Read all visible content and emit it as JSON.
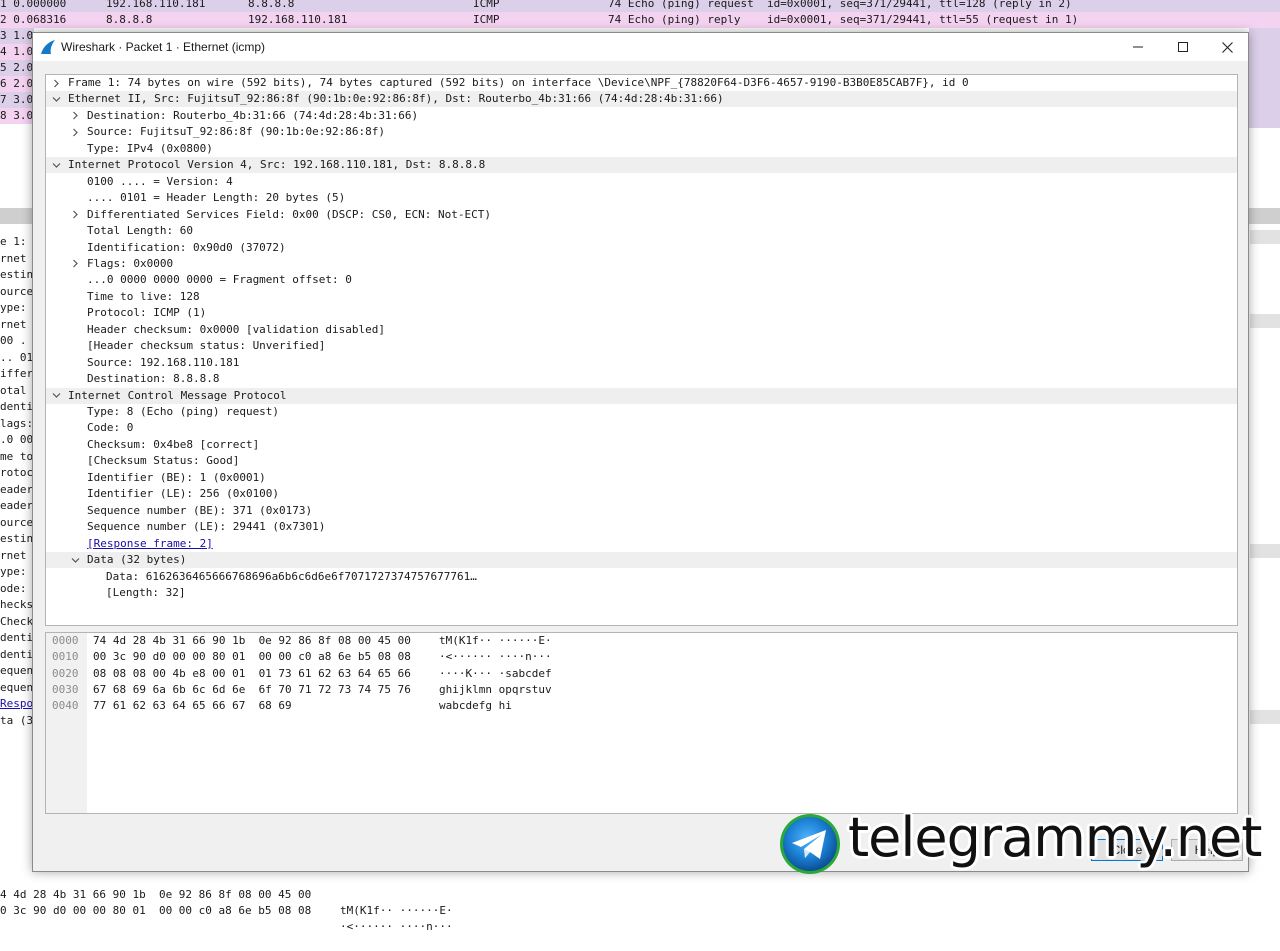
{
  "background": {
    "packet_list": [
      {
        "no_time": "1 0.000000",
        "source": "192.168.110.181",
        "destination": "8.8.8.8",
        "protocol": "ICMP",
        "info": "74 Echo (ping) request  id=0x0001, seq=371/29441, ttl=128 (reply in 2)"
      },
      {
        "no_time": "2 0.068316",
        "source": "8.8.8.8",
        "destination": "192.168.110.181",
        "protocol": "ICMP",
        "info": "74 Echo (ping) reply    id=0x0001, seq=371/29441, ttl=55 (request in 1)"
      },
      {
        "no_time": "3 1.0"
      },
      {
        "no_time": "4 1.0"
      },
      {
        "no_time": "5 2.0"
      },
      {
        "no_time": "6 2.0"
      },
      {
        "no_time": "7 3.0"
      },
      {
        "no_time": "8 3.0"
      }
    ],
    "detail_fragments": [
      "e 1: ",
      "rnet ",
      "estina",
      "ource",
      "ype: ",
      "rnet ",
      "00 .",
      ".. 01",
      "iffer",
      "otal ",
      "denti",
      "lags:",
      ".0 00",
      "me to",
      "rotoc",
      "eader",
      "eader",
      "ource",
      "estina",
      "rnet ",
      "ype: ",
      "ode: ",
      "hecks",
      "Checks",
      "dentif",
      "dentif",
      "equen",
      "equen",
      "Respo",
      "ta (3"
    ],
    "bytes_lines": [
      {
        "hex": "4 4d 28 4b 31 66 90 1b  0e 92 86 8f 08 00 45 00",
        "ascii": "tM(K1f·· ······E·"
      },
      {
        "hex": "0 3c 90 d0 00 00 80 01  00 00 c0 a8 6e b5 08 08",
        "ascii": "·<······ ····n···"
      }
    ]
  },
  "dialog": {
    "title": "Wireshark · Packet 1 · Ethernet (icmp)",
    "tree": [
      {
        "level": 0,
        "expander": "collapsed",
        "section": false,
        "text": "Frame 1: 74 bytes on wire (592 bits), 74 bytes captured (592 bits) on interface \\Device\\NPF_{78820F64-D3F6-4657-9190-B3B0E85CAB7F}, id 0"
      },
      {
        "level": 0,
        "expander": "expanded",
        "section": true,
        "text": "Ethernet II, Src: FujitsuT_92:86:8f (90:1b:0e:92:86:8f), Dst: Routerbo_4b:31:66 (74:4d:28:4b:31:66)"
      },
      {
        "level": 1,
        "expander": "collapsed",
        "section": false,
        "text": "Destination: Routerbo_4b:31:66 (74:4d:28:4b:31:66)"
      },
      {
        "level": 1,
        "expander": "collapsed",
        "section": false,
        "text": "Source: FujitsuT_92:86:8f (90:1b:0e:92:86:8f)"
      },
      {
        "level": 1,
        "expander": "none",
        "section": false,
        "text": "Type: IPv4 (0x0800)"
      },
      {
        "level": 0,
        "expander": "expanded",
        "section": true,
        "text": "Internet Protocol Version 4, Src: 192.168.110.181, Dst: 8.8.8.8"
      },
      {
        "level": 1,
        "expander": "none",
        "section": false,
        "text": "0100 .... = Version: 4"
      },
      {
        "level": 1,
        "expander": "none",
        "section": false,
        "text": ".... 0101 = Header Length: 20 bytes (5)"
      },
      {
        "level": 1,
        "expander": "collapsed",
        "section": false,
        "text": "Differentiated Services Field: 0x00 (DSCP: CS0, ECN: Not-ECT)"
      },
      {
        "level": 1,
        "expander": "none",
        "section": false,
        "text": "Total Length: 60"
      },
      {
        "level": 1,
        "expander": "none",
        "section": false,
        "text": "Identification: 0x90d0 (37072)"
      },
      {
        "level": 1,
        "expander": "collapsed",
        "section": false,
        "text": "Flags: 0x0000"
      },
      {
        "level": 1,
        "expander": "none",
        "section": false,
        "text": "...0 0000 0000 0000 = Fragment offset: 0"
      },
      {
        "level": 1,
        "expander": "none",
        "section": false,
        "text": "Time to live: 128"
      },
      {
        "level": 1,
        "expander": "none",
        "section": false,
        "text": "Protocol: ICMP (1)"
      },
      {
        "level": 1,
        "expander": "none",
        "section": false,
        "text": "Header checksum: 0x0000 [validation disabled]"
      },
      {
        "level": 1,
        "expander": "none",
        "section": false,
        "text": "[Header checksum status: Unverified]"
      },
      {
        "level": 1,
        "expander": "none",
        "section": false,
        "text": "Source: 192.168.110.181"
      },
      {
        "level": 1,
        "expander": "none",
        "section": false,
        "text": "Destination: 8.8.8.8"
      },
      {
        "level": 0,
        "expander": "expanded",
        "section": true,
        "text": "Internet Control Message Protocol"
      },
      {
        "level": 1,
        "expander": "none",
        "section": false,
        "text": "Type: 8 (Echo (ping) request)"
      },
      {
        "level": 1,
        "expander": "none",
        "section": false,
        "text": "Code: 0"
      },
      {
        "level": 1,
        "expander": "none",
        "section": false,
        "text": "Checksum: 0x4be8 [correct]"
      },
      {
        "level": 1,
        "expander": "none",
        "section": false,
        "text": "[Checksum Status: Good]"
      },
      {
        "level": 1,
        "expander": "none",
        "section": false,
        "text": "Identifier (BE): 1 (0x0001)"
      },
      {
        "level": 1,
        "expander": "none",
        "section": false,
        "text": "Identifier (LE): 256 (0x0100)"
      },
      {
        "level": 1,
        "expander": "none",
        "section": false,
        "text": "Sequence number (BE): 371 (0x0173)"
      },
      {
        "level": 1,
        "expander": "none",
        "section": false,
        "text": "Sequence number (LE): 29441 (0x7301)"
      },
      {
        "level": 1,
        "expander": "none",
        "section": false,
        "link": true,
        "text": "[Response frame: 2]"
      },
      {
        "level": 1,
        "expander": "expanded",
        "section": true,
        "text": "Data (32 bytes)"
      },
      {
        "level": 2,
        "expander": "none",
        "section": false,
        "text": "Data: 6162636465666768696a6b6c6d6e6f7071727374757677761…"
      },
      {
        "level": 2,
        "expander": "none",
        "section": false,
        "text": "[Length: 32]"
      }
    ],
    "bytes": [
      {
        "offset": "0000",
        "hex": "74 4d 28 4b 31 66 90 1b  0e 92 86 8f 08 00 45 00",
        "ascii": "tM(K1f·· ······E·"
      },
      {
        "offset": "0010",
        "hex": "00 3c 90 d0 00 00 80 01  00 00 c0 a8 6e b5 08 08",
        "ascii": "·<······ ····n···"
      },
      {
        "offset": "0020",
        "hex": "08 08 08 00 4b e8 00 01  01 73 61 62 63 64 65 66",
        "ascii": "····K··· ·sabcdef"
      },
      {
        "offset": "0030",
        "hex": "67 68 69 6a 6b 6c 6d 6e  6f 70 71 72 73 74 75 76",
        "ascii": "ghijklmn opqrstuv"
      },
      {
        "offset": "0040",
        "hex": "77 61 62 63 64 65 66 67  68 69",
        "ascii": "wabcdefg hi"
      }
    ],
    "buttons": {
      "close": "Close",
      "help": "Help"
    }
  },
  "watermark": {
    "text": "telegrammy.net"
  },
  "colors": {
    "request_row": "#dccfe9",
    "reply_row": "#f4d3f1",
    "section_row": "#efefef",
    "link": "#1a0dab"
  },
  "icons": {
    "app": "wireshark-fin-icon",
    "minimize": "minimize-icon",
    "maximize": "maximize-icon",
    "close": "close-icon",
    "expanded": "chevron-down-icon",
    "collapsed": "chevron-right-icon",
    "watermark": "telegram-logo-icon"
  }
}
